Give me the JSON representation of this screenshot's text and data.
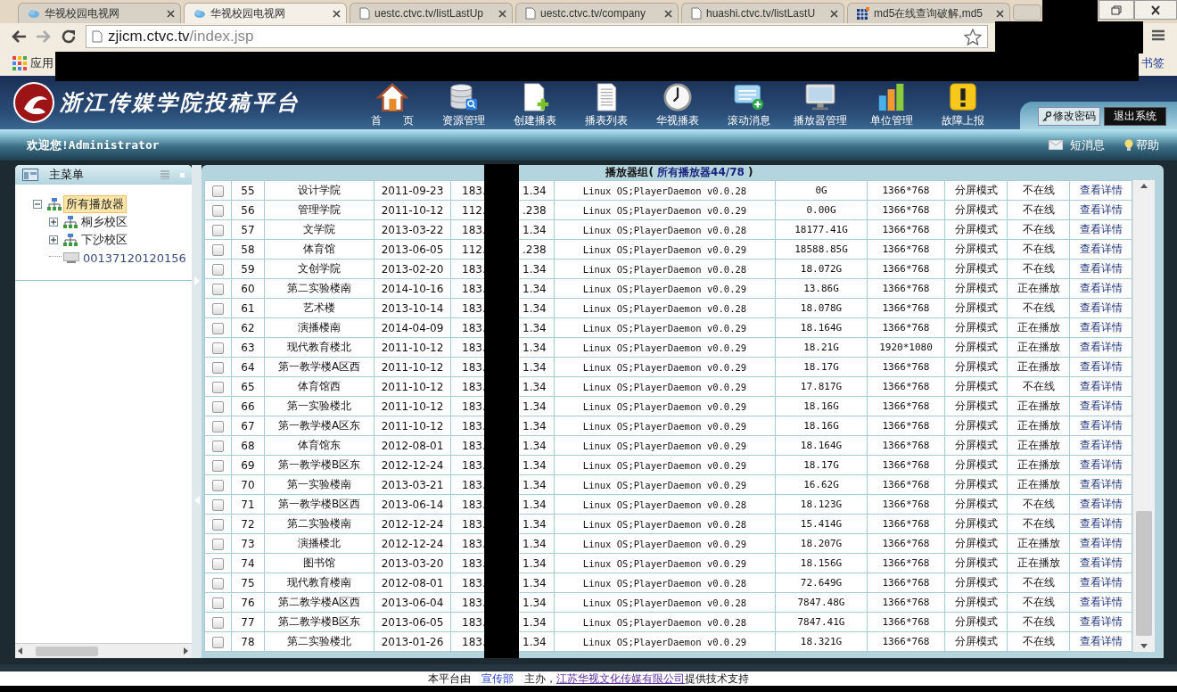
{
  "browser": {
    "tabs": [
      {
        "title": "华视校园电视网",
        "kind": "site",
        "selected": false
      },
      {
        "title": "华视校园电视网",
        "kind": "site",
        "selected": true
      },
      {
        "title": "uestc.ctvc.tv/listLastUp",
        "kind": "page",
        "selected": false
      },
      {
        "title": "uestc.ctvc.tv/company",
        "kind": "page",
        "selected": false
      },
      {
        "title": "huashi.ctvc.tv/listLastU",
        "kind": "page",
        "selected": false
      },
      {
        "title": "md5在线查询破解,md5",
        "kind": "app",
        "selected": false
      }
    ],
    "url_host": "zjicm.ctvc.tv",
    "url_path": "/index.jsp",
    "apps_label": "应用",
    "bookmarks_label": "书签"
  },
  "header": {
    "title": "浙江传媒学院投稿平台",
    "nav": [
      "首　　页",
      "资源管理",
      "创建播表",
      "播表列表",
      "华视播表",
      "滚动消息",
      "播放器管理",
      "单位管理",
      "故障上报"
    ],
    "change_password": "修改密码",
    "logout": "退出系统"
  },
  "welcome": {
    "greeting": "欢迎您!Administrator",
    "messages": "短消息",
    "help": "帮助"
  },
  "sidebar": {
    "title": "主菜单",
    "tree": [
      {
        "label": "所有播放器",
        "kind": "group",
        "selected": true,
        "expanded": true,
        "children": [
          {
            "label": "桐乡校区",
            "kind": "group",
            "selected": false,
            "expanded": false
          },
          {
            "label": "下沙校区",
            "kind": "group",
            "selected": false,
            "expanded": false
          },
          {
            "label": "00137120120156",
            "kind": "device",
            "selected": false
          }
        ]
      }
    ]
  },
  "panel": {
    "title_prefix": "播放器组(",
    "title_group": "所有播放器44/78",
    "title_suffix": ")"
  },
  "rows": [
    {
      "no": "55",
      "name": "设计学院",
      "date": "2011-09-23",
      "ip_prefix": "183.",
      "ip_suffix": "1.34",
      "os": "Linux OS;PlayerDaemon v0.0.28",
      "size": "0G",
      "resolution": "1366*768",
      "mode": "分屏模式",
      "status": "不在线",
      "action": "查看详情",
      "checked": false
    },
    {
      "no": "56",
      "name": "管理学院",
      "date": "2011-10-12",
      "ip_prefix": "112.",
      "ip_suffix": ".238",
      "os": "Linux OS;PlayerDaemon v0.0.29",
      "size": "0.00G",
      "resolution": "1366*768",
      "mode": "分屏模式",
      "status": "不在线",
      "action": "查看详情",
      "checked": false
    },
    {
      "no": "57",
      "name": "文学院",
      "date": "2013-03-22",
      "ip_prefix": "183.",
      "ip_suffix": "1.34",
      "os": "Linux OS;PlayerDaemon v0.0.28",
      "size": "18177.41G",
      "resolution": "1366*768",
      "mode": "分屏模式",
      "status": "不在线",
      "action": "查看详情",
      "checked": false
    },
    {
      "no": "58",
      "name": "体育馆",
      "date": "2013-06-05",
      "ip_prefix": "112.",
      "ip_suffix": ".238",
      "os": "Linux OS;PlayerDaemon v0.0.29",
      "size": "18588.85G",
      "resolution": "1366*768",
      "mode": "分屏模式",
      "status": "不在线",
      "action": "查看详情",
      "checked": false
    },
    {
      "no": "59",
      "name": "文创学院",
      "date": "2013-02-20",
      "ip_prefix": "183.",
      "ip_suffix": "1.34",
      "os": "Linux OS;PlayerDaemon v0.0.28",
      "size": "18.072G",
      "resolution": "1366*768",
      "mode": "分屏模式",
      "status": "不在线",
      "action": "查看详情",
      "checked": false
    },
    {
      "no": "60",
      "name": "第二实验楼南",
      "date": "2014-10-16",
      "ip_prefix": "183.",
      "ip_suffix": "1.34",
      "os": "Linux OS;PlayerDaemon v0.0.29",
      "size": "13.86G",
      "resolution": "1366*768",
      "mode": "分屏模式",
      "status": "正在播放",
      "action": "查看详情",
      "checked": false
    },
    {
      "no": "61",
      "name": "艺术楼",
      "date": "2013-10-14",
      "ip_prefix": "183.",
      "ip_suffix": "1.34",
      "os": "Linux OS;PlayerDaemon v0.0.28",
      "size": "18.078G",
      "resolution": "1366*768",
      "mode": "分屏模式",
      "status": "不在线",
      "action": "查看详情",
      "checked": false
    },
    {
      "no": "62",
      "name": "演播楼南",
      "date": "2014-04-09",
      "ip_prefix": "183.",
      "ip_suffix": "1.34",
      "os": "Linux OS;PlayerDaemon v0.0.29",
      "size": "18.164G",
      "resolution": "1366*768",
      "mode": "分屏模式",
      "status": "正在播放",
      "action": "查看详情",
      "checked": false
    },
    {
      "no": "63",
      "name": "现代教育楼北",
      "date": "2011-10-12",
      "ip_prefix": "183.",
      "ip_suffix": "1.34",
      "os": "Linux OS;PlayerDaemon v0.0.29",
      "size": "18.21G",
      "resolution": "1920*1080",
      "mode": "分屏模式",
      "status": "正在播放",
      "action": "查看详情",
      "checked": false
    },
    {
      "no": "64",
      "name": "第一教学楼A区西",
      "date": "2011-10-12",
      "ip_prefix": "183.",
      "ip_suffix": "1.34",
      "os": "Linux OS;PlayerDaemon v0.0.29",
      "size": "18.17G",
      "resolution": "1366*768",
      "mode": "分屏模式",
      "status": "正在播放",
      "action": "查看详情",
      "checked": false
    },
    {
      "no": "65",
      "name": "体育馆西",
      "date": "2011-10-12",
      "ip_prefix": "183.",
      "ip_suffix": "1.34",
      "os": "Linux OS;PlayerDaemon v0.0.29",
      "size": "17.817G",
      "resolution": "1366*768",
      "mode": "分屏模式",
      "status": "不在线",
      "action": "查看详情",
      "checked": false
    },
    {
      "no": "66",
      "name": "第一实验楼北",
      "date": "2011-10-12",
      "ip_prefix": "183.",
      "ip_suffix": "1.34",
      "os": "Linux OS;PlayerDaemon v0.0.29",
      "size": "18.16G",
      "resolution": "1366*768",
      "mode": "分屏模式",
      "status": "正在播放",
      "action": "查看详情",
      "checked": false
    },
    {
      "no": "67",
      "name": "第一教学楼A区东",
      "date": "2011-10-12",
      "ip_prefix": "183.",
      "ip_suffix": "1.34",
      "os": "Linux OS;PlayerDaemon v0.0.29",
      "size": "18.16G",
      "resolution": "1366*768",
      "mode": "分屏模式",
      "status": "正在播放",
      "action": "查看详情",
      "checked": false
    },
    {
      "no": "68",
      "name": "体育馆东",
      "date": "2012-08-01",
      "ip_prefix": "183.",
      "ip_suffix": "1.34",
      "os": "Linux OS;PlayerDaemon v0.0.29",
      "size": "18.164G",
      "resolution": "1366*768",
      "mode": "分屏模式",
      "status": "正在播放",
      "action": "查看详情",
      "checked": false
    },
    {
      "no": "69",
      "name": "第一教学楼B区东",
      "date": "2012-12-24",
      "ip_prefix": "183.",
      "ip_suffix": "1.34",
      "os": "Linux OS;PlayerDaemon v0.0.29",
      "size": "18.17G",
      "resolution": "1366*768",
      "mode": "分屏模式",
      "status": "正在播放",
      "action": "查看详情",
      "checked": false
    },
    {
      "no": "70",
      "name": "第一实验楼南",
      "date": "2013-03-21",
      "ip_prefix": "183.",
      "ip_suffix": "1.34",
      "os": "Linux OS;PlayerDaemon v0.0.29",
      "size": "16.62G",
      "resolution": "1366*768",
      "mode": "分屏模式",
      "status": "正在播放",
      "action": "查看详情",
      "checked": false
    },
    {
      "no": "71",
      "name": "第一教学楼B区西",
      "date": "2013-06-14",
      "ip_prefix": "183.",
      "ip_suffix": "1.34",
      "os": "Linux OS;PlayerDaemon v0.0.28",
      "size": "18.123G",
      "resolution": "1366*768",
      "mode": "分屏模式",
      "status": "不在线",
      "action": "查看详情",
      "checked": false
    },
    {
      "no": "72",
      "name": "第二实验楼南",
      "date": "2012-12-24",
      "ip_prefix": "183.",
      "ip_suffix": "1.34",
      "os": "Linux OS;PlayerDaemon v0.0.28",
      "size": "15.414G",
      "resolution": "1366*768",
      "mode": "分屏模式",
      "status": "不在线",
      "action": "查看详情",
      "checked": false
    },
    {
      "no": "73",
      "name": "演播楼北",
      "date": "2012-12-24",
      "ip_prefix": "183.",
      "ip_suffix": "1.34",
      "os": "Linux OS;PlayerDaemon v0.0.29",
      "size": "18.207G",
      "resolution": "1366*768",
      "mode": "分屏模式",
      "status": "正在播放",
      "action": "查看详情",
      "checked": false
    },
    {
      "no": "74",
      "name": "图书馆",
      "date": "2013-03-20",
      "ip_prefix": "183.",
      "ip_suffix": "1.34",
      "os": "Linux OS;PlayerDaemon v0.0.29",
      "size": "18.156G",
      "resolution": "1366*768",
      "mode": "分屏模式",
      "status": "正在播放",
      "action": "查看详情",
      "checked": false
    },
    {
      "no": "75",
      "name": "现代教育楼南",
      "date": "2012-08-01",
      "ip_prefix": "183.",
      "ip_suffix": "1.34",
      "os": "Linux OS;PlayerDaemon v0.0.28",
      "size": "72.649G",
      "resolution": "1366*768",
      "mode": "分屏模式",
      "status": "不在线",
      "action": "查看详情",
      "checked": false
    },
    {
      "no": "76",
      "name": "第二教学楼A区西",
      "date": "2013-06-04",
      "ip_prefix": "183.",
      "ip_suffix": "1.34",
      "os": "Linux OS;PlayerDaemon v0.0.28",
      "size": "7847.48G",
      "resolution": "1366*768",
      "mode": "分屏模式",
      "status": "不在线",
      "action": "查看详情",
      "checked": false
    },
    {
      "no": "77",
      "name": "第二教学楼B区东",
      "date": "2013-06-05",
      "ip_prefix": "183.",
      "ip_suffix": "1.34",
      "os": "Linux OS;PlayerDaemon v0.0.28",
      "size": "7847.41G",
      "resolution": "1366*768",
      "mode": "分屏模式",
      "status": "不在线",
      "action": "查看详情",
      "checked": false
    },
    {
      "no": "78",
      "name": "第二实验楼北",
      "date": "2013-01-26",
      "ip_prefix": "183.",
      "ip_suffix": "1.34",
      "os": "Linux OS;PlayerDaemon v0.0.29",
      "size": "18.321G",
      "resolution": "1366*768",
      "mode": "分屏模式",
      "status": "不在线",
      "action": "查看详情",
      "checked": false
    }
  ],
  "footer": {
    "before": "本平台由",
    "link1": "宣传部",
    "middle": "主办，",
    "link2": "江苏华视文化传媒有限公司",
    "after": "提供技术支持"
  }
}
